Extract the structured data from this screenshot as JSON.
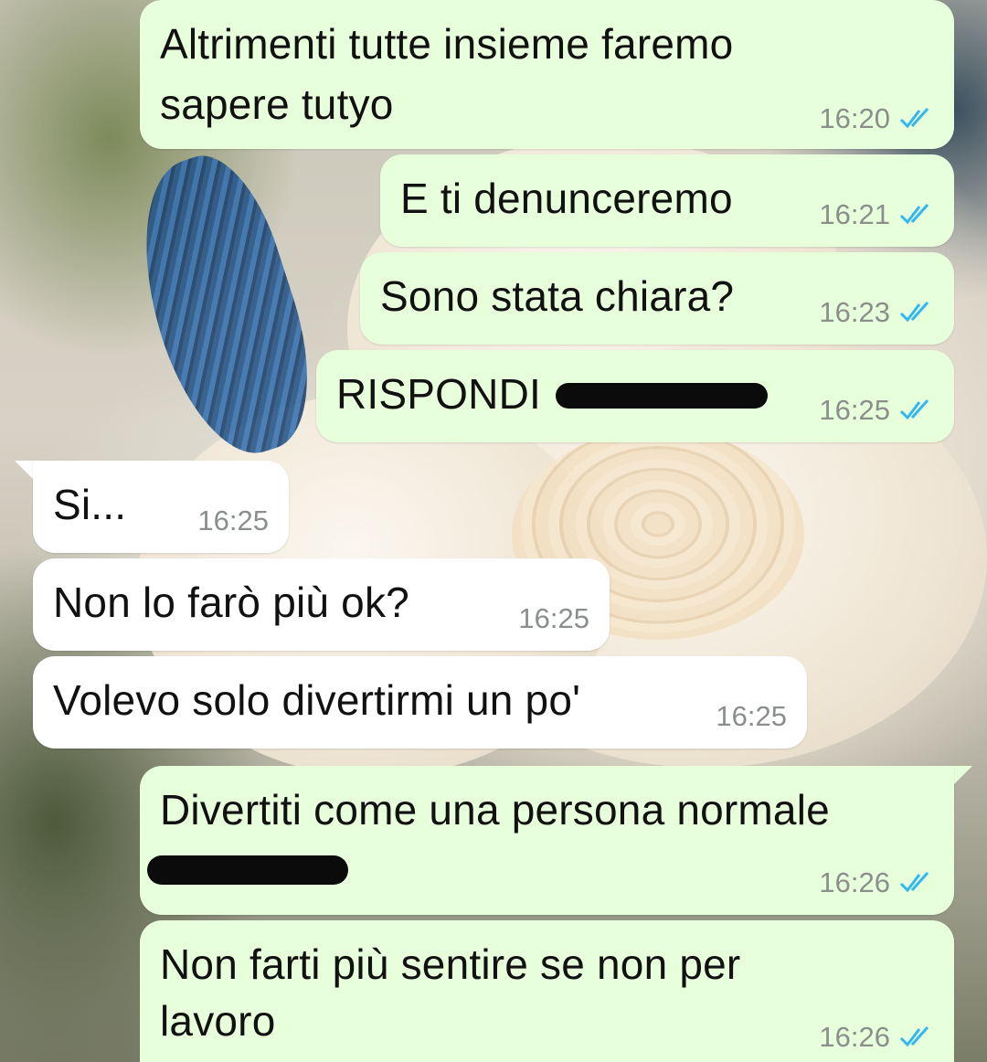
{
  "messages": [
    {
      "dir": "out",
      "lines": [
        "Altrimenti tutte insieme faremo",
        "sapere tutyo"
      ],
      "time": "16:20",
      "read": true
    },
    {
      "dir": "out",
      "lines": [
        "E ti denunceremo"
      ],
      "time": "16:21",
      "read": true
    },
    {
      "dir": "out",
      "lines": [
        "Sono stata chiara?"
      ],
      "time": "16:23",
      "read": true
    },
    {
      "dir": "out",
      "lines": [
        "RISPONDI"
      ],
      "time": "16:25",
      "read": true,
      "redacted": true
    },
    {
      "dir": "in",
      "lines": [
        "Si..."
      ],
      "time": "16:25"
    },
    {
      "dir": "in",
      "lines": [
        "Non lo farò più ok?"
      ],
      "time": "16:25"
    },
    {
      "dir": "in",
      "lines": [
        "Volevo solo divertirmi un po'"
      ],
      "time": "16:25"
    },
    {
      "dir": "out",
      "lines": [
        "Divertiti come una persona normale"
      ],
      "time": "16:26",
      "read": true,
      "redacted": true
    },
    {
      "dir": "out",
      "lines": [
        "Non farti più sentire se non per",
        "lavoro"
      ],
      "time": "16:26",
      "read": true
    }
  ],
  "colors": {
    "outgoing_bubble": "#e7ffdb",
    "incoming_bubble": "#ffffff",
    "read_ticks": "#34b7f1",
    "timestamp": "#8a8f8c",
    "redaction": "#0b0b0b"
  },
  "icons": {
    "read_receipt": "double-check-icon"
  }
}
